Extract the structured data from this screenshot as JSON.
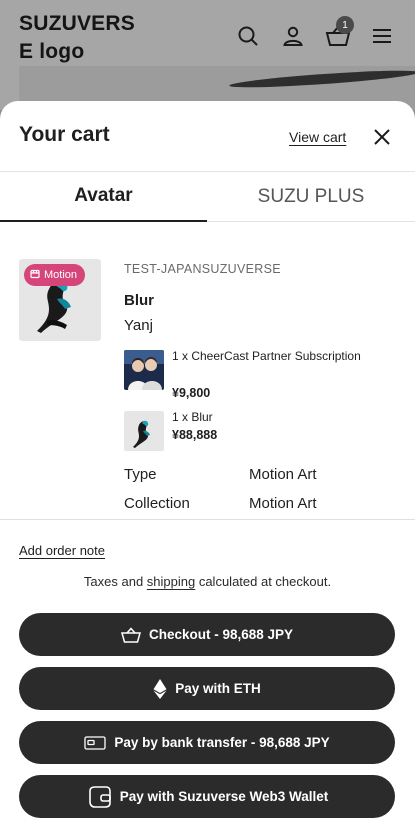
{
  "header": {
    "logo_line1": "SUZUVERS",
    "logo_line2": "E logo",
    "cart_count": "1",
    "icons": [
      "search-icon",
      "account-icon",
      "cart-icon",
      "menu-icon"
    ]
  },
  "drawer": {
    "title": "Your cart",
    "view_cart_label": "View cart",
    "close_icon": "close-icon",
    "tabs": [
      {
        "label": "Avatar",
        "active": true
      },
      {
        "label": "SUZU PLUS",
        "active": false
      }
    ]
  },
  "cart_item": {
    "badge_label": "Motion",
    "vendor": "TEST-JAPANSUZUVERSE",
    "title": "Blur",
    "artist": "Yanj",
    "bundle": [
      {
        "name": "1 x CheerCast Partner Subscription",
        "price": "¥9,800"
      },
      {
        "name": "1 x Blur",
        "price": "¥88,888"
      }
    ],
    "properties": [
      {
        "key": "Type",
        "value": "Motion Art"
      },
      {
        "key": "Collection",
        "value": "Motion Art"
      }
    ]
  },
  "footer": {
    "order_note_label": "Add order note",
    "tax_prefix": "Taxes and ",
    "tax_link": "shipping",
    "tax_suffix": " calculated at checkout.",
    "buttons": [
      {
        "label": "Checkout - 98,688 JPY",
        "icon": "basket-icon"
      },
      {
        "label": "Pay with ETH",
        "icon": "ethereum-icon"
      },
      {
        "label": "Pay by bank transfer - 98,688 JPY",
        "icon": "bank-card-icon"
      },
      {
        "label": "Pay with Suzuverse Web3 Wallet",
        "icon": "wallet-icon"
      }
    ]
  },
  "colors": {
    "accent_badge": "#d6457a",
    "button_bg": "#2b2b2b",
    "overlay_bg": "#a6a6a6"
  }
}
